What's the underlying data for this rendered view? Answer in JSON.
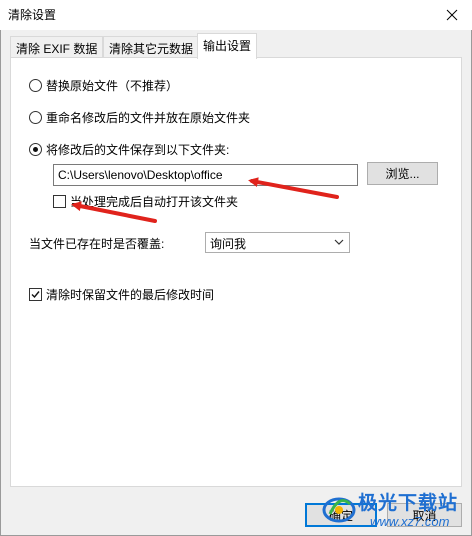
{
  "window": {
    "title": "清除设置"
  },
  "tabs": [
    {
      "label": "清除 EXIF 数据"
    },
    {
      "label": "清除其它元数据"
    },
    {
      "label": "输出设置"
    }
  ],
  "output": {
    "options": [
      {
        "label": "替换原始文件（不推荐）",
        "checked": false
      },
      {
        "label": "重命名修改后的文件并放在原始文件夹",
        "checked": false
      },
      {
        "label": "将修改后的文件保存到以下文件夹:",
        "checked": true
      }
    ],
    "folder_path": "C:\\Users\\lenovo\\Desktop\\office",
    "browse_label": "浏览...",
    "auto_open_label": "当处理完成后自动打开该文件夹",
    "auto_open_checked": false,
    "overwrite_label": "当文件已存在时是否覆盖:",
    "overwrite_value": "询问我",
    "keep_time_label": "清除时保留文件的最后修改时间",
    "keep_time_checked": true
  },
  "footer": {
    "ok_label": "确定",
    "cancel_label": "取消"
  },
  "watermark": {
    "text": "极光下载站",
    "url": "www.xz7.com"
  },
  "colors": {
    "annotation_arrow": "#e0231c",
    "accent": "#0078d7"
  }
}
